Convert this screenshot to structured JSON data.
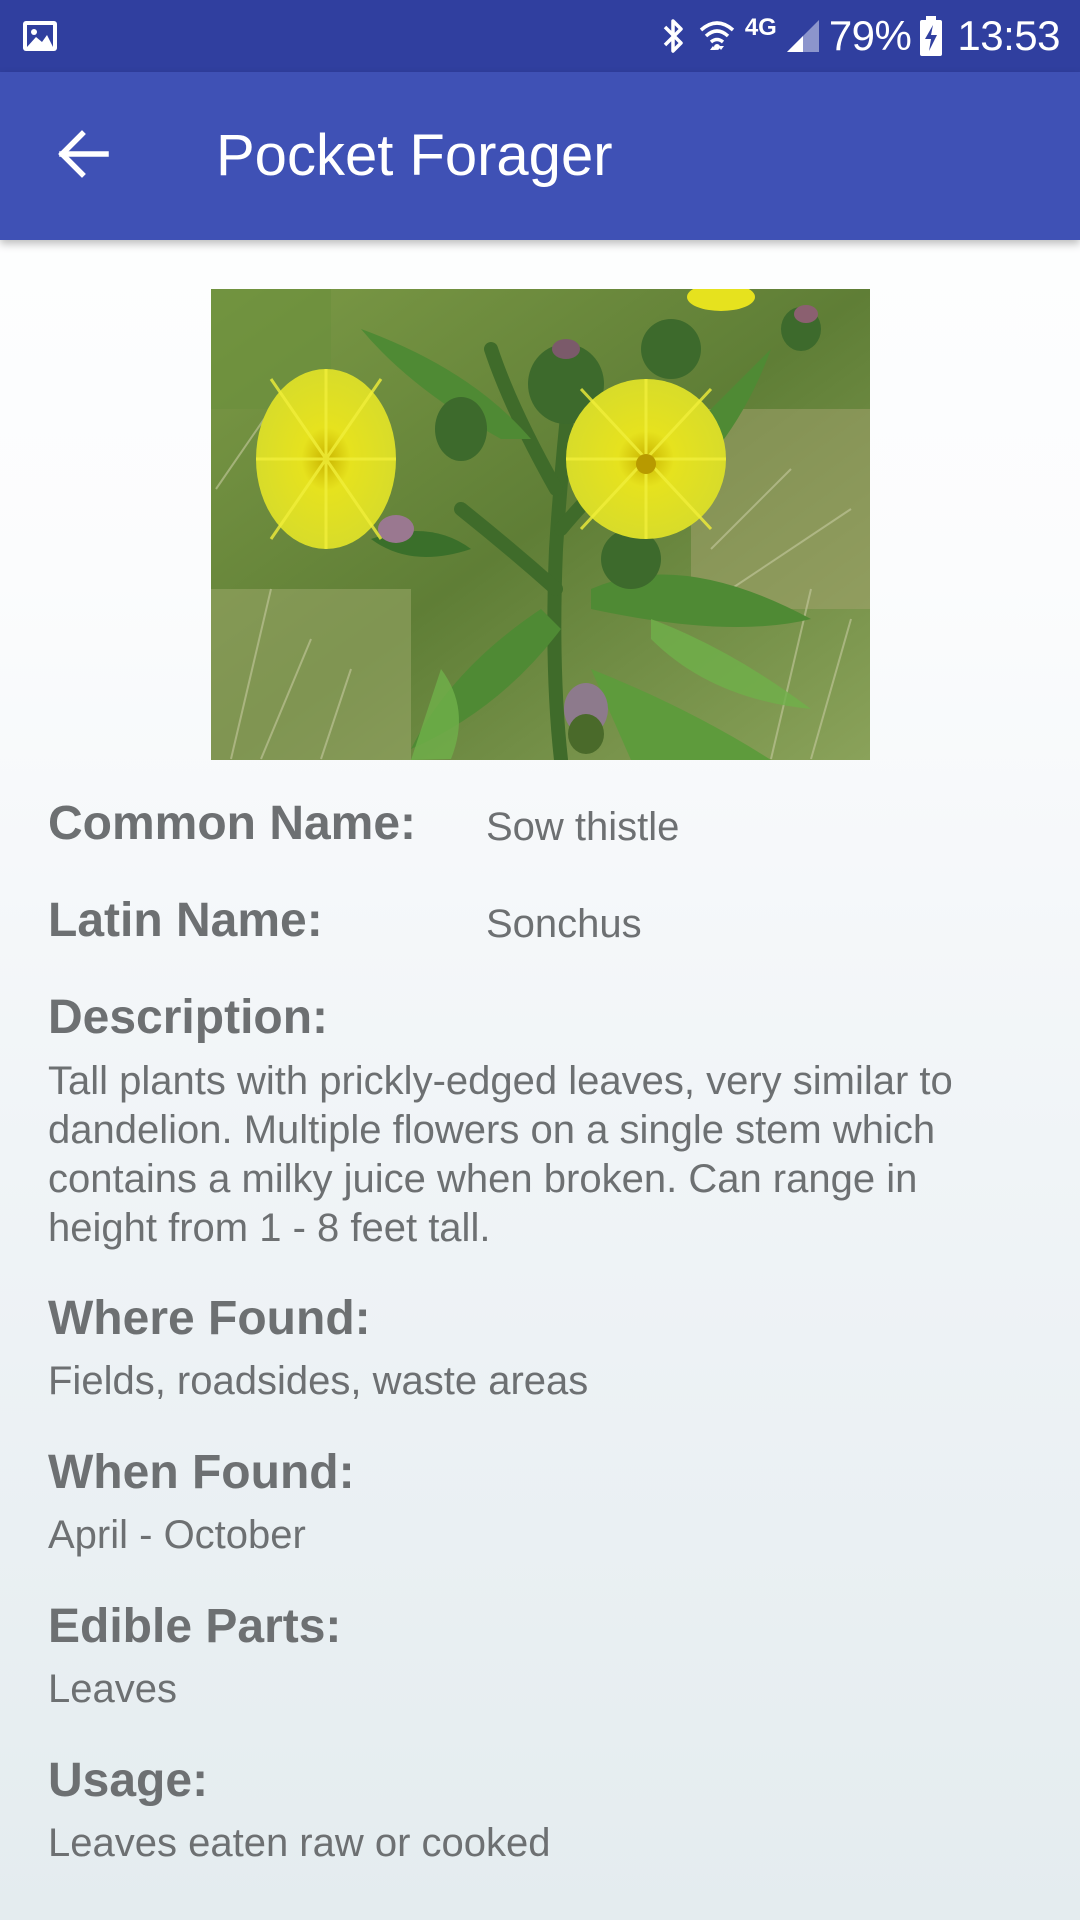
{
  "status_bar": {
    "gallery_icon": "image-icon",
    "bluetooth_icon": "bluetooth-icon",
    "wifi_icon": "wifi-icon",
    "network_label": "4G",
    "signal_icon": "cell-signal-icon",
    "battery_percent": "79%",
    "battery_icon": "battery-charging-icon",
    "time": "13:53"
  },
  "app_bar": {
    "back_icon": "arrow-back-icon",
    "title": "Pocket Forager",
    "background": "#3f51b5",
    "status_background": "#303f9f"
  },
  "plant": {
    "image_icon": "plant-photo",
    "common_name_label": "Common Name:",
    "common_name": "Sow thistle",
    "latin_name_label": "Latin Name:",
    "latin_name": "Sonchus",
    "description_label": "Description:",
    "description": "Tall plants with prickly-edged leaves, very similar to dandelion. Multiple flowers on a single stem which contains a milky juice when broken. Can range in height from 1 - 8 feet tall.",
    "where_found_label": "Where Found:",
    "where_found": "Fields, roadsides, waste areas",
    "when_found_label": "When Found:",
    "when_found": "April - October",
    "edible_parts_label": "Edible Parts:",
    "edible_parts": "Leaves",
    "usage_label": "Usage:",
    "usage": "Leaves eaten raw or cooked"
  }
}
